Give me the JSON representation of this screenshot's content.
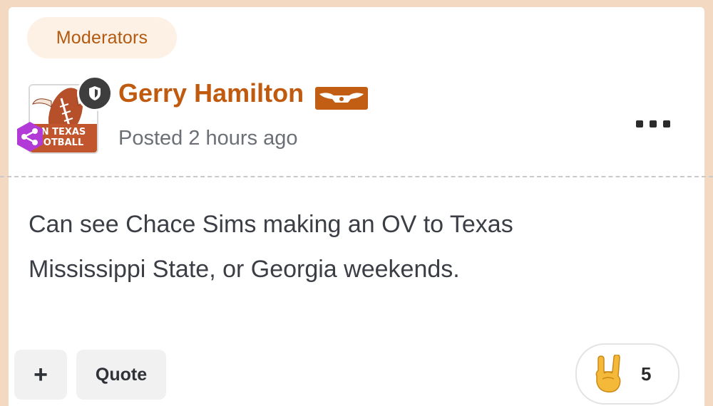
{
  "post": {
    "role_label": "Moderators",
    "author": "Gerry Hamilton",
    "posted": "Posted 2 hours ago",
    "body_line1": "Can see Chace Sims making an OV to Texas",
    "body_line2": "Mississippi State, or Georgia weekends.",
    "avatar_text_line1": "N TEXAS",
    "avatar_text_line2": "OTBALL"
  },
  "actions": {
    "plus_label": "+",
    "quote_label": "Quote"
  },
  "reactions": {
    "icon": "horns-hand-icon",
    "count": "5"
  },
  "colors": {
    "accent": "#bf5a0e",
    "page_bg": "#f3d9c2",
    "pill_bg": "#fdf0e4",
    "badge_purple": "#b23ad6"
  }
}
